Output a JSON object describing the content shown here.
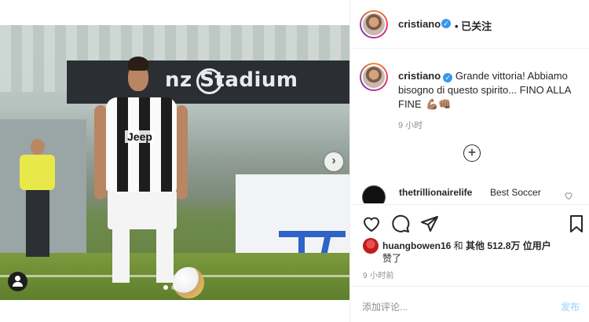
{
  "header": {
    "username": "cristiano",
    "verified_mark": "✓",
    "follow_status": "• 已关注"
  },
  "photo": {
    "stadium_text": "nz Stadium",
    "jersey_text": "Jeep",
    "carousel_next": "›",
    "carousel_dots": 2,
    "carousel_active_index": 0
  },
  "caption": {
    "username": "cristiano",
    "text": "Grande vittoria! Abbiamo bisogno di questo spirito... FINO ALLA FINE",
    "emojis": "💪🏽👊🏽",
    "time": "9 小时",
    "load_more": "+"
  },
  "comment": {
    "username": "thetrillionairelife",
    "text": "Best Soccer"
  },
  "likes": {
    "liker": "huangbowen16",
    "and": " 和 ",
    "others_prefix": "其他 ",
    "count": "512.8万",
    "others_suffix": " 位用户",
    "liked": "赞了"
  },
  "post_time": "9 小时前",
  "add_comment": {
    "placeholder": "添加评论...",
    "publish": "发布"
  },
  "colors": {
    "accent": "#3897f0",
    "publish_disabled": "#b2dffc",
    "muted": "#8e8e8e"
  },
  "icons": [
    "heart-icon",
    "comment-icon",
    "share-icon",
    "bookmark-icon",
    "user-tag-icon",
    "chevron-right-icon",
    "plus-circle-icon",
    "verified-badge-icon"
  ]
}
